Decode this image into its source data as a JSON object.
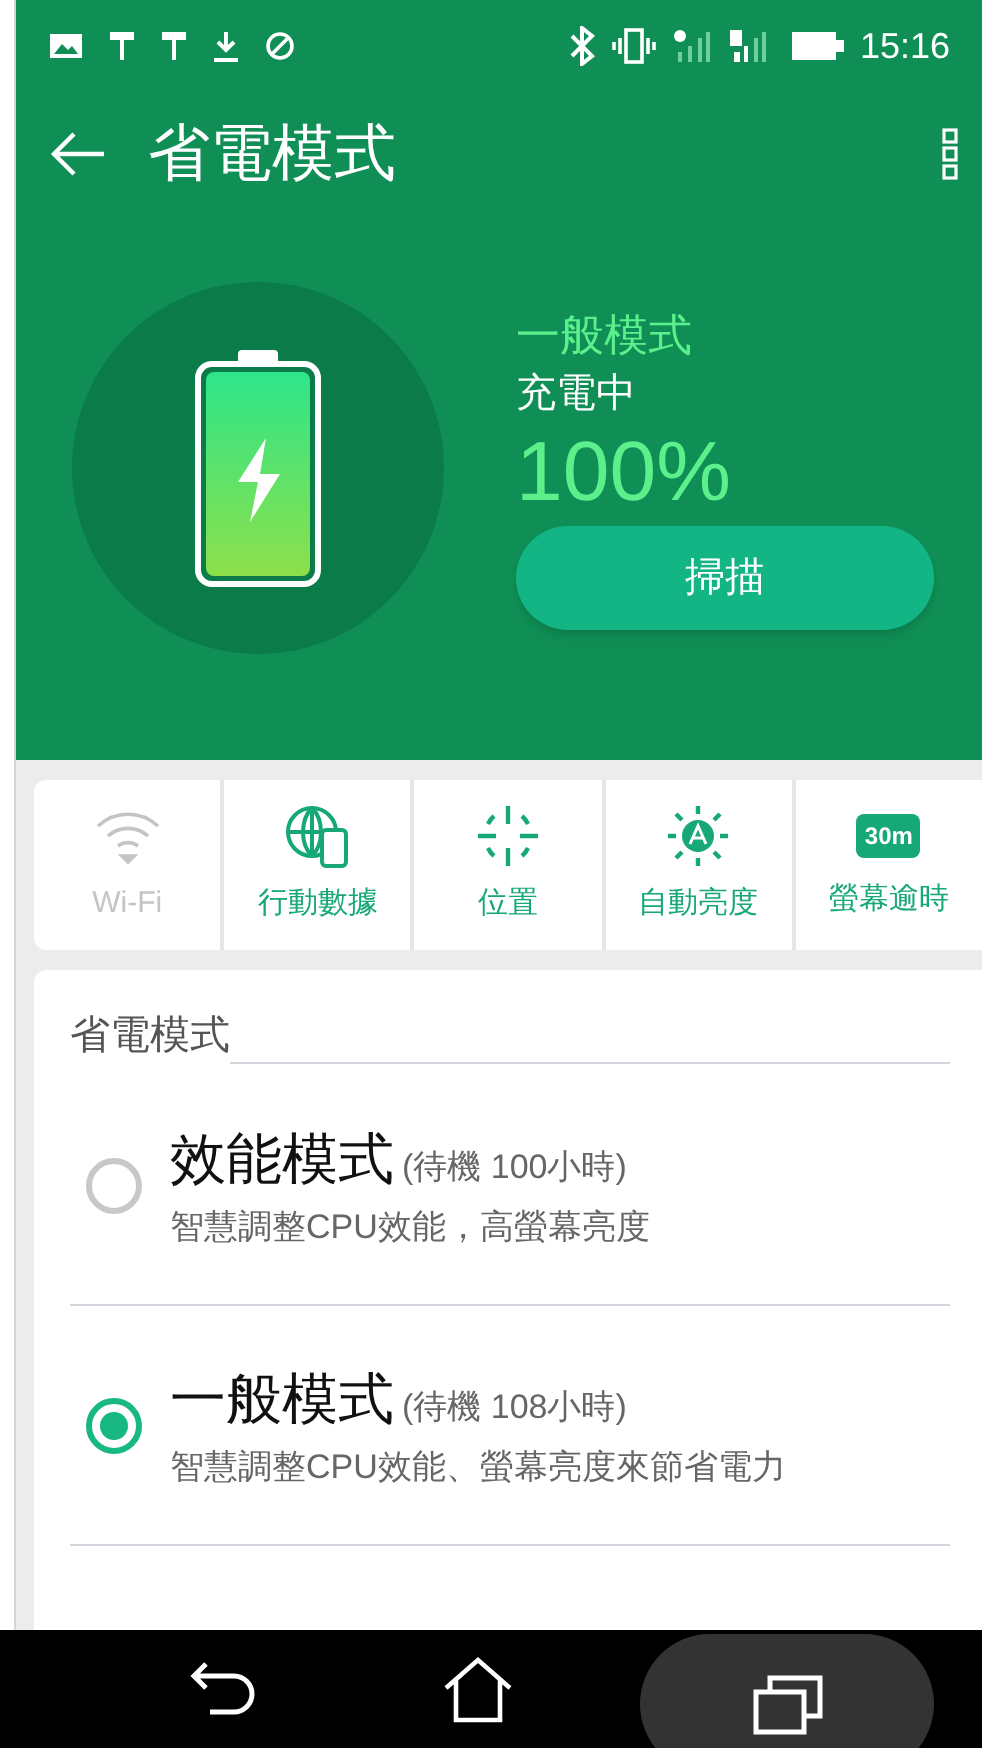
{
  "status_bar": {
    "time": "15:16"
  },
  "app_bar": {
    "title": "省電模式"
  },
  "summary": {
    "mode": "一般模式",
    "charging": "充電中",
    "percent": "100%",
    "level": 1.0,
    "scan_button": "掃描"
  },
  "quick_settings": [
    {
      "kind": "wifi",
      "label": "Wi-Fi",
      "on": false
    },
    {
      "kind": "data",
      "label": "行動數據",
      "on": true
    },
    {
      "kind": "location",
      "label": "位置",
      "on": true
    },
    {
      "kind": "brightness",
      "label": "自動亮度",
      "on": true
    },
    {
      "kind": "timeout",
      "label": "螢幕逾時",
      "badge": "30m",
      "on": true
    }
  ],
  "section": {
    "title": "省電模式",
    "modes": [
      {
        "name": "效能模式",
        "standby": "(待機 100小時)",
        "description": "智慧調整CPU效能，高螢幕亮度",
        "selected": false
      },
      {
        "name": "一般模式",
        "standby": "(待機 108小時)",
        "description": "智慧調整CPU效能、螢幕亮度來節省電力",
        "selected": true
      }
    ]
  }
}
